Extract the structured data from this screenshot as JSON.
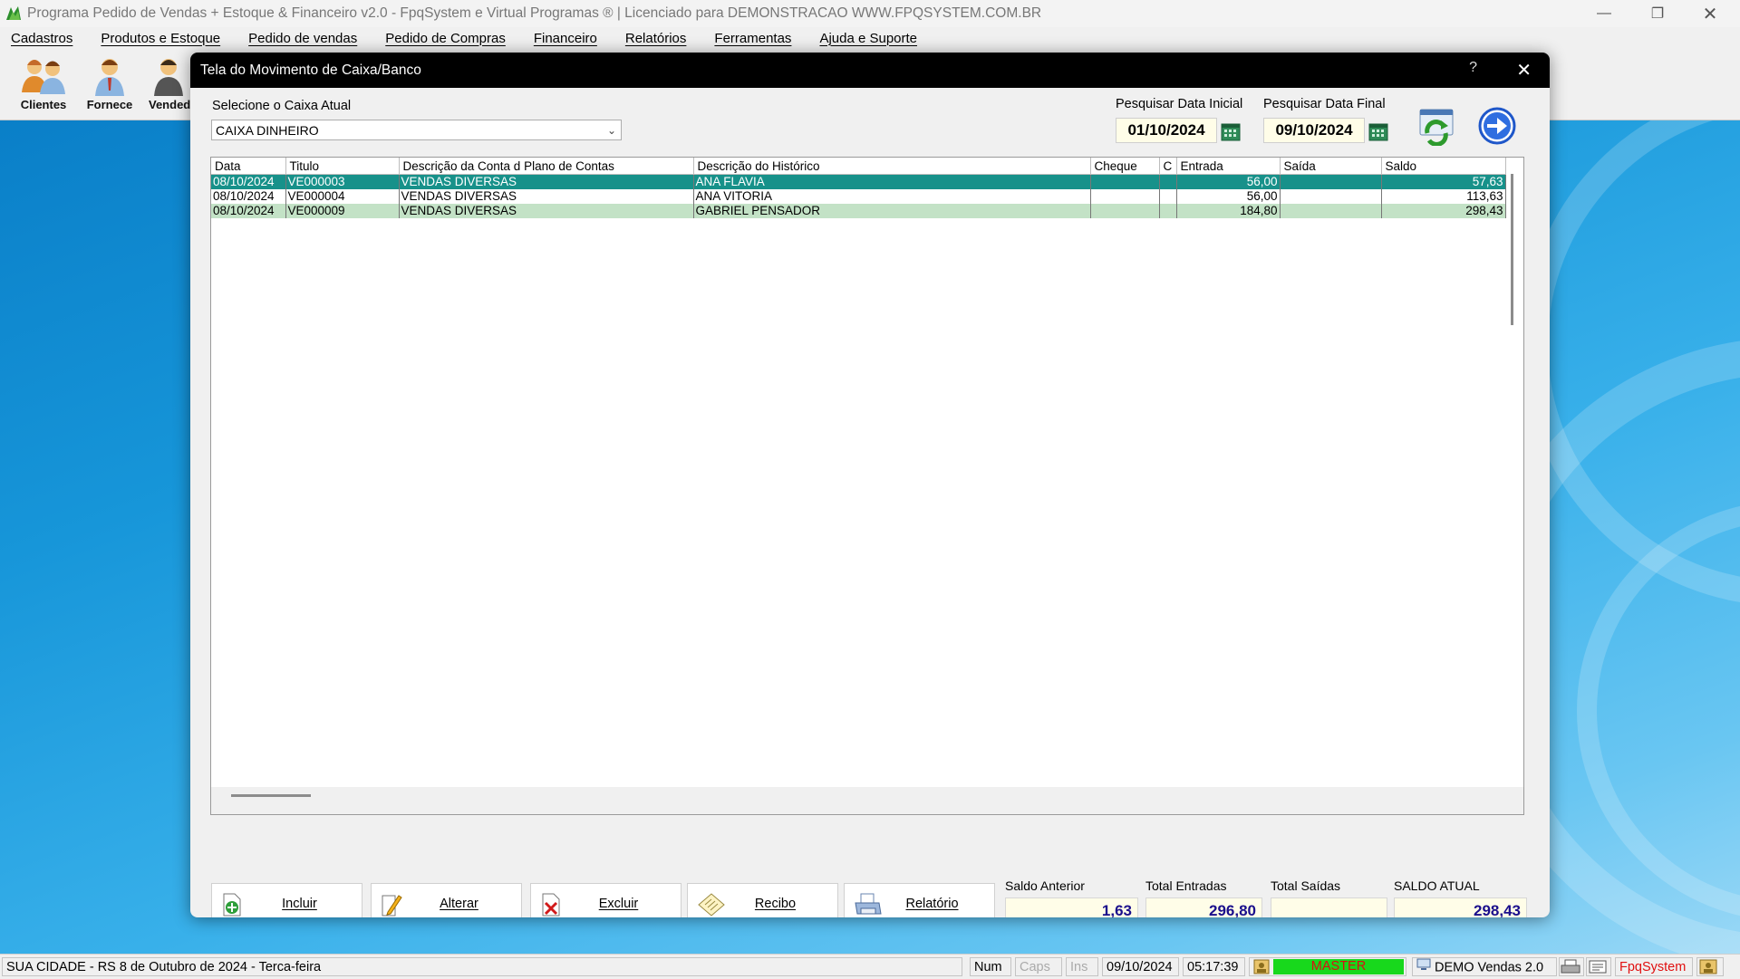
{
  "app": {
    "title": "Programa Pedido de Vendas + Estoque & Financeiro v2.0 - FpqSystem e Virtual Programas ® | Licenciado para  DEMONSTRACAO WWW.FPQSYSTEM.COM.BR"
  },
  "menu": [
    "Cadastros",
    "Produtos e Estoque",
    "Pedido de vendas",
    "Pedido de Compras",
    "Financeiro",
    "Relatórios",
    "Ferramentas",
    "Ajuda e Suporte"
  ],
  "toolbar": [
    "Clientes",
    "Fornece",
    "Vended"
  ],
  "dialog": {
    "title": "Tela do Movimento de Caixa/Banco",
    "help": "?",
    "close": "✕",
    "caixa_label": "Selecione o Caixa Atual",
    "caixa_value": "CAIXA DINHEIRO",
    "data_inicial_label": "Pesquisar Data Inicial",
    "data_inicial": "01/10/2024",
    "data_final_label": "Pesquisar Data Final",
    "data_final": "09/10/2024"
  },
  "grid": {
    "columns": [
      "Data",
      "Titulo",
      "Descrição da Conta d Plano de Contas",
      "Descrição do Histórico",
      "Cheque",
      "C",
      "Entrada",
      "Saída",
      "Saldo"
    ],
    "rows": [
      [
        "08/10/2024",
        "VE000003",
        "VENDAS DIVERSAS",
        "ANA FLAVIA",
        "",
        "",
        "56,00",
        "",
        "57,63"
      ],
      [
        "08/10/2024",
        "VE000004",
        "VENDAS DIVERSAS",
        "ANA VITORIA",
        "",
        "",
        "56,00",
        "",
        "113,63"
      ],
      [
        "08/10/2024",
        "VE000009",
        "VENDAS DIVERSAS",
        "GABRIEL PENSADOR",
        "",
        "",
        "184,80",
        "",
        "298,43"
      ]
    ]
  },
  "buttons": {
    "incluir": "Incluir",
    "alterar": "Alterar",
    "excluir": "Excluir",
    "recibo": "Recibo",
    "relatorio": "Relatório"
  },
  "totals": {
    "saldo_anterior_label": "Saldo Anterior",
    "saldo_anterior": "1,63",
    "total_entradas_label": "Total Entradas",
    "total_entradas": "296,80",
    "total_saidas_label": "Total Saídas",
    "total_saidas": "",
    "saldo_atual_label": "SALDO ATUAL",
    "saldo_atual": "298,43"
  },
  "statusbar": {
    "location": "SUA CIDADE - RS  8 de Outubro de 2024 - Terca-feira",
    "num": "Num",
    "caps": "Caps",
    "ins": "Ins",
    "date": "09/10/2024",
    "time": "05:17:39",
    "user": "MASTER",
    "version": "DEMO Vendas 2.0",
    "brand": "FpqSystem"
  },
  "colors": {
    "selected_row": "#17918a",
    "alt_row": "#c3e2c6",
    "total_text": "#1b0f8c",
    "user_badge": "#18d81c",
    "brand_text": "#e01010"
  }
}
